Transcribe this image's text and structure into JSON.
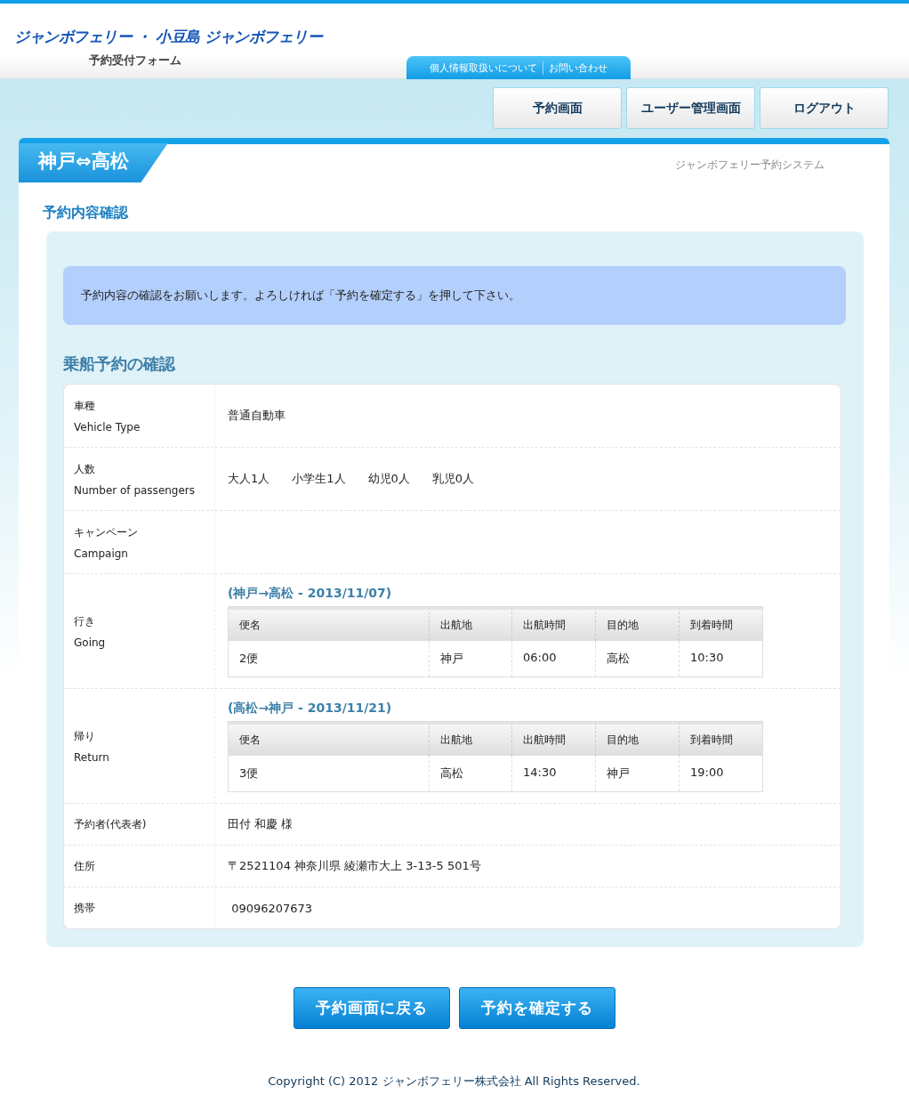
{
  "header": {
    "logo": "ジャンボフェリー ・ 小豆島 ジャンボフェリー",
    "subtitle": "予約受付フォーム",
    "links": [
      "個人情報取扱いについて",
      "お問い合わせ"
    ]
  },
  "nav": [
    "予約画面",
    "ユーザー管理画面",
    "ログアウト"
  ],
  "route_tab": "神戸⇔高松",
  "system_name": "ジャンボフェリー予約システム",
  "section_title": "予約内容確認",
  "notice": "予約内容の確認をお願いします。よろしければ「予約を確定する」を押して下さい。",
  "heading": "乗船予約の確認",
  "rows": [
    {
      "kind": "text",
      "label": "車種",
      "label_en": "Vehicle Type",
      "value": "普通自動車"
    },
    {
      "kind": "passengers",
      "label": "人数",
      "label_en": "Number of passengers",
      "items": [
        "大人1人",
        "小学生1人",
        "幼児0人",
        "乳児0人"
      ]
    },
    {
      "kind": "text",
      "label": "キャンペーン",
      "label_en": "Campaign"
    },
    {
      "kind": "voyage",
      "label": "行き",
      "label_en": "Going",
      "route": "(神戸→高松 - 2013/11/07)",
      "columns": [
        "便名",
        "出航地",
        "出航時間",
        "目的地",
        "到着時間"
      ],
      "cells": [
        "2便",
        "神戸",
        "06:00",
        "高松",
        "10:30"
      ]
    },
    {
      "kind": "voyage",
      "label": "帰り",
      "label_en": "Return",
      "route": "(高松→神戸 - 2013/11/21)",
      "columns": [
        "便名",
        "出航地",
        "出航時間",
        "目的地",
        "到着時間"
      ],
      "cells": [
        "3便",
        "高松",
        "14:30",
        "神戸",
        "19:00"
      ]
    },
    {
      "kind": "text",
      "label": "予約者(代表者)",
      "value": "田付 和慶 様"
    },
    {
      "kind": "text",
      "label": "住所",
      "value": "〒2521104 神奈川県 綾瀬市大上 3-13-5 501号"
    },
    {
      "kind": "text",
      "label": "携帯",
      "value": " 09096207673"
    }
  ],
  "buttons": [
    "予約画面に戻る",
    "予約を確定する"
  ],
  "copyright": "Copyright (C) 2012 ジャンボフェリー株式会社 All Rights Reserved."
}
